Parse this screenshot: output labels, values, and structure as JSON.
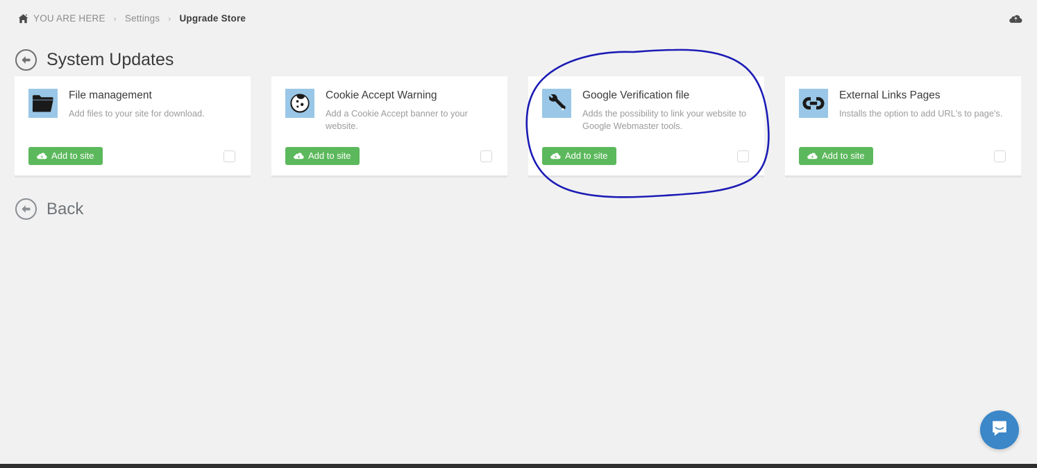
{
  "header": {
    "breadcrumb": {
      "home_icon": "home-icon",
      "items": [
        {
          "label": "YOU ARE HERE",
          "current": false
        },
        {
          "label": "Settings",
          "current": false
        },
        {
          "label": "Upgrade Store",
          "current": true
        }
      ],
      "separator": "›"
    },
    "topright_icon": "cloud-upload-icon"
  },
  "page": {
    "title": "System Updates",
    "back_icon": "circle-arrow-left-icon"
  },
  "cards": [
    {
      "icon": "folder-icon",
      "title": "File management",
      "description": "Add files to your site for download.",
      "button_label": "Add to site",
      "button_icon": "cloud-download-icon",
      "checkbox_checked": false
    },
    {
      "icon": "cookie-icon",
      "title": "Cookie Accept Warning",
      "description": "Add a Cookie Accept banner to your website.",
      "button_label": "Add to site",
      "button_icon": "cloud-download-icon",
      "checkbox_checked": false
    },
    {
      "icon": "wrench-icon",
      "title": "Google Verification file",
      "description": "Adds the possibility to link your website to Google Webmaster tools.",
      "button_label": "Add to site",
      "button_icon": "cloud-download-icon",
      "checkbox_checked": false,
      "annotated": true
    },
    {
      "icon": "link-chain-icon",
      "title": "External Links Pages",
      "description": "Installs the option to add URL's to page's.",
      "button_label": "Add to site",
      "button_icon": "cloud-download-icon",
      "checkbox_checked": false
    }
  ],
  "back": {
    "label": "Back",
    "icon": "circle-arrow-left-icon"
  },
  "chat": {
    "icon": "intercom-message-icon"
  },
  "annotation": {
    "shape": "hand-drawn-ellipse",
    "color": "#1b1bb5",
    "target": "Google Verification file"
  },
  "colors": {
    "background": "#f1f1f1",
    "card_background": "#ffffff",
    "button_green": "#5cb85c",
    "icon_tile_blue": "#9ac7e7",
    "chat_blue": "#3b87c8",
    "annotation_blue": "#1b1bb5"
  }
}
